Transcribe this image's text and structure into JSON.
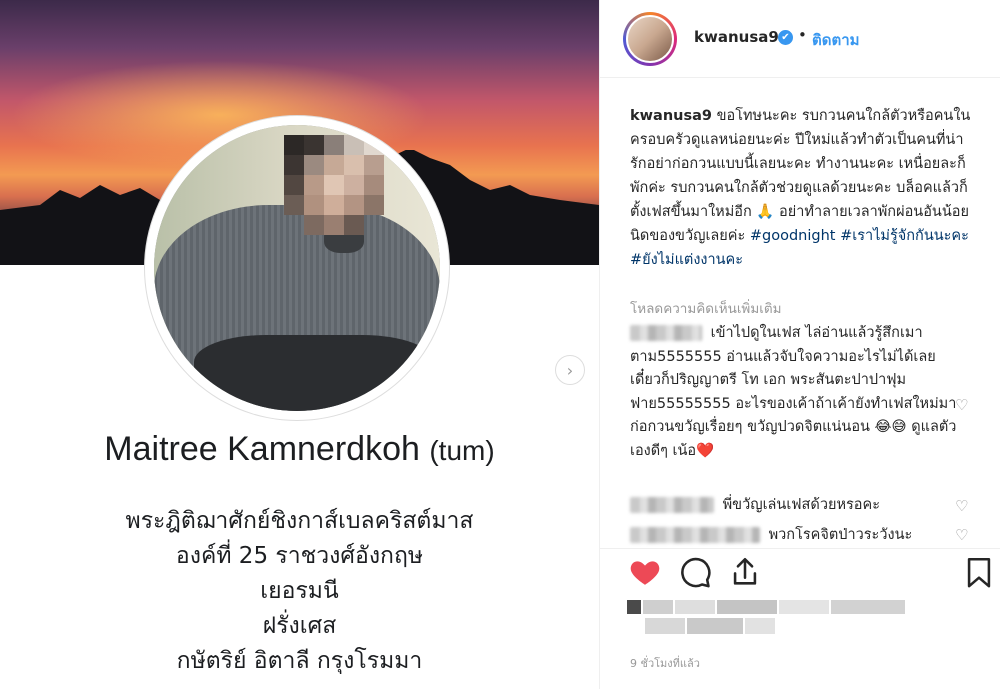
{
  "post_image": {
    "profile_name": "Maitree Kamnerdkoh",
    "profile_nick": "(tum)",
    "description_lines": [
      "พระฎิติฌาศักย์ชิงกาส์เบลคริสต์มาส",
      "องค์ที่ 25 ราชวงศ์อังกฤษ",
      "เยอรมนี",
      "ฝรั่งเศส",
      "กษัตริย์ อิตาลี กรุงโรมมา"
    ],
    "next_icon": "chevron-right-icon"
  },
  "header": {
    "username": "kwanusa9",
    "verified_icon": "verified-badge-icon",
    "separator": "•",
    "follow_label": "ติดตาม"
  },
  "caption": {
    "username": "kwanusa9",
    "text": "ขอโทษนะคะ รบกวนคนใกล้ตัวหรือคนในครอบครัวดูแลหน่อยนะค่ะ ปีใหม่แล้วทำตัวเป็นคนที่น่ารักอย่าก่อกวนแบบนี้เลยนะคะ ทำงานนะคะ เหนื่อยละก็พักค่ะ รบกวนคนใกล้ตัวช่วยดูแลด้วยนะคะ บล็อคแล้วก็ตั้งเฟสขึ้นมาใหม่อีก 🙏 อย่าทำลายเวลาพักผ่อนอันน้อยนิดของขวัญเลยค่ะ",
    "hashtags": [
      "#goodnight",
      "#เราไม่รู้จักกันนะคะ",
      "#ยังไม่แต่งงานคะ"
    ]
  },
  "load_more_label": "โหลดความคิดเห็นเพิ่มเติม",
  "comments": [
    {
      "text": "เข้าไปดูในเฟส ไล่อ่านแล้วรู้สึกเมาตาม5555555 อ่านแล้วจับใจความอะไรไม่ได้เลย เดี๋ยวก็ปริญญาตรี โท เอก พระสันตะปาปาฟุมฟาย55555555 อะไรของเค้าถ้าเค้ายังทำเฟสใหม่มาก่อกวนขวัญเรื่อยๆ ขวัญปวดจิตแน่นอน 😂😅 ดูแลตัวเองดีๆ เน้อ❤️"
    },
    {
      "text": "พี่ขวัญเล่นเฟสด้วยหรอคะ"
    },
    {
      "text": "พวกโรคจิตป่าวระวังนะ"
    }
  ],
  "actions": {
    "like_icon": "heart-filled-icon",
    "comment_icon": "comment-bubble-icon",
    "share_icon": "share-upload-icon",
    "save_icon": "bookmark-icon",
    "like_color": "#ed4956"
  },
  "timestamp": "9 ชั่วโมงที่แล้ว",
  "colors": {
    "link": "#3897f0",
    "hashtag": "#003569",
    "muted": "#999999"
  }
}
